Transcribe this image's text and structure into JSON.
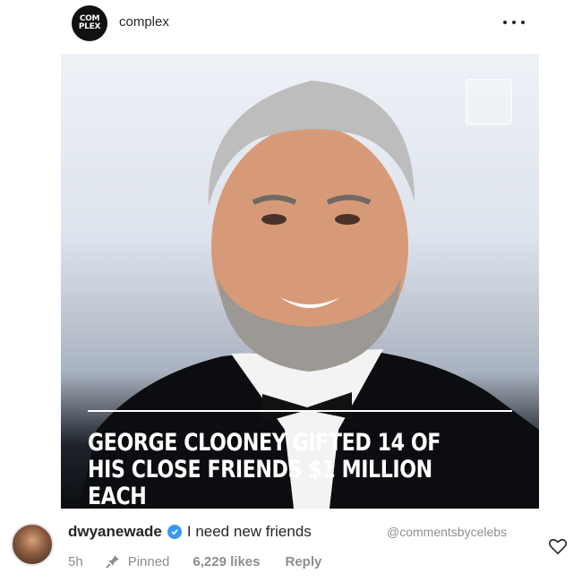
{
  "header": {
    "avatar_line1": "COM",
    "avatar_line2": "PLEX",
    "account": "complex",
    "more_icon": "more-horizontal-icon"
  },
  "post": {
    "headline": "GEORGE CLOONEY GIFTED 14 OF HIS CLOSE FRIENDS $1 MILLION EACH",
    "watermark_icon": "complex-watermark-icon"
  },
  "comment": {
    "username": "dwyanewade",
    "verified_icon": "verified-badge-icon",
    "text": "I need new friends",
    "credit": "@commentsbycelebs",
    "time": "5h",
    "pinned_label": "Pinned",
    "likes": "6,229 likes",
    "reply": "Reply",
    "pin_icon": "pin-icon",
    "like_icon": "heart-icon"
  },
  "colors": {
    "text": "#262626",
    "muted": "#8e8e8e",
    "verified": "#3897f0"
  }
}
